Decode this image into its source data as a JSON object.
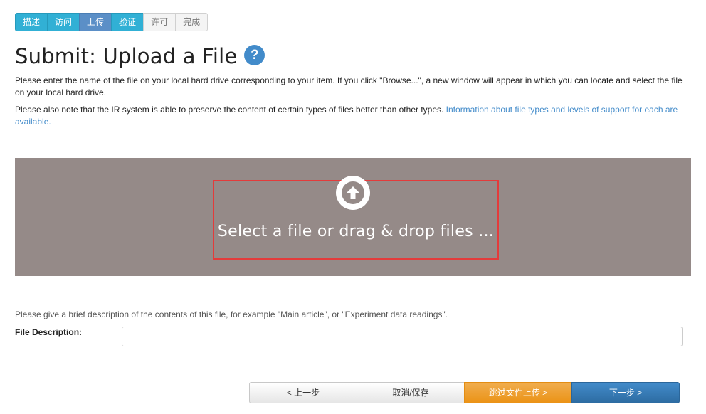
{
  "progress": {
    "steps": [
      {
        "label": "描述",
        "state": "done"
      },
      {
        "label": "访问",
        "state": "done"
      },
      {
        "label": "上传",
        "state": "current"
      },
      {
        "label": "验证",
        "state": "done"
      },
      {
        "label": "许可",
        "state": "todo"
      },
      {
        "label": "完成",
        "state": "todo"
      }
    ]
  },
  "page": {
    "title": "Submit: Upload a File",
    "help_icon": "question-mark-icon",
    "help_glyph": "?"
  },
  "instructions": {
    "p1": "Please enter the name of the file on your local hard drive corresponding to your item. If you click \"Browse...\", a new window will appear in which you can locate and select the file on your local hard drive.",
    "p2_text": "Please also note that the IR system is able to preserve the content of certain types of files better than other types. ",
    "p2_link": "Information about file types and levels of support for each are available."
  },
  "upload": {
    "icon": "upload-arrow-icon",
    "text": "Select a file or drag & drop files ...",
    "background": "#958a88",
    "highlight_color": "#e33b3b"
  },
  "description": {
    "hint": "Please give a brief description of the contents of this file, for example \"Main article\", or \"Experiment data readings\".",
    "label": "File Description:",
    "value": "",
    "placeholder": ""
  },
  "buttons": {
    "prev": "< 上一步",
    "cancel": "取消/保存",
    "skip": "跳过文件上传 >",
    "next": "下一步 >"
  },
  "colors": {
    "step_done": "#31b0d5",
    "step_current": "#5b8fc7",
    "skip": "#f0ad4e",
    "next": "#428bca"
  }
}
